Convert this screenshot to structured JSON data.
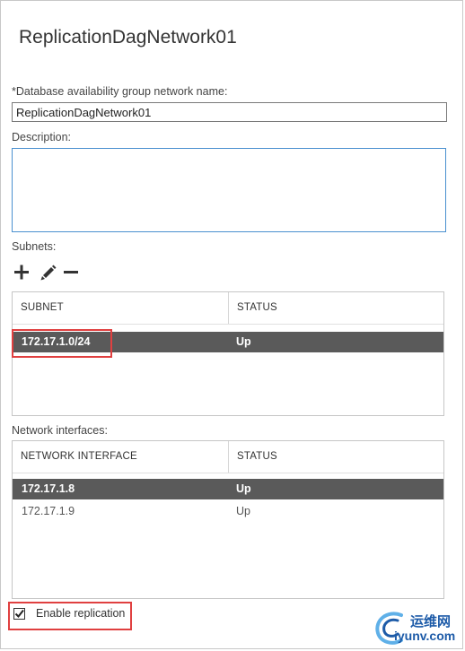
{
  "dialog": {
    "title": "ReplicationDagNetwork01"
  },
  "form": {
    "name_label": "*Database availability group network name:",
    "name_value": "ReplicationDagNetwork01",
    "description_label": "Description:",
    "description_value": "",
    "subnets_label": "Subnets:",
    "network_interfaces_label": "Network interfaces:",
    "enable_replication_label": "Enable replication",
    "enable_replication_checked": true
  },
  "subnet_toolbar": {
    "icons": [
      "add-icon",
      "edit-icon",
      "remove-icon"
    ]
  },
  "subnets_table": {
    "columns": [
      "SUBNET",
      "STATUS"
    ],
    "rows": [
      {
        "subnet": "172.17.1.0/24",
        "status": "Up",
        "selected": true
      }
    ]
  },
  "interfaces_table": {
    "columns": [
      "NETWORK INTERFACE",
      "STATUS"
    ],
    "rows": [
      {
        "interface": "172.17.1.8",
        "status": "Up",
        "selected": true
      },
      {
        "interface": "172.17.1.9",
        "status": "Up",
        "selected": false
      }
    ]
  },
  "watermark": {
    "text_cn": "运维网",
    "text_en": "iyunv.com"
  },
  "colors": {
    "selected_row": "#5a5a5a",
    "highlight_box": "#e04040",
    "focus_border": "#4a90d0",
    "watermark": "#1d5ba8"
  }
}
